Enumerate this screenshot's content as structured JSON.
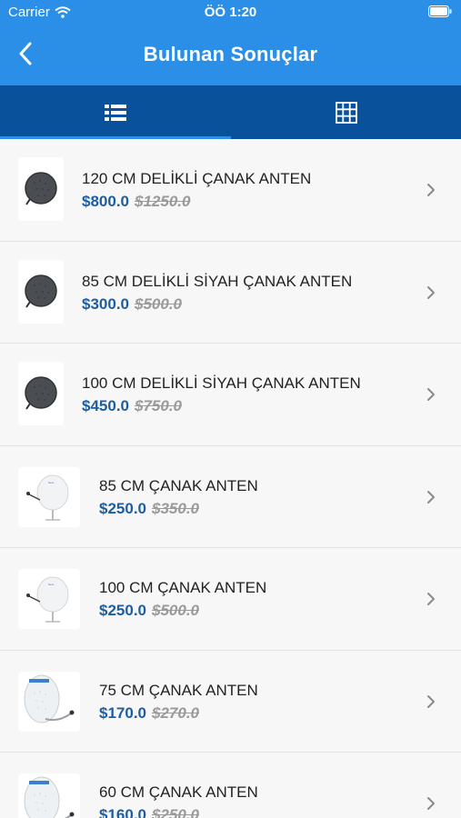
{
  "status_bar": {
    "carrier": "Carrier",
    "time": "ÖÖ 1:20"
  },
  "nav": {
    "title": "Bulunan Sonuçlar",
    "back_icon": "chevron-left-icon"
  },
  "tabs": [
    {
      "icon": "list-icon",
      "active": true
    },
    {
      "icon": "grid-icon",
      "active": false
    }
  ],
  "colors": {
    "header": "#2b8fe8",
    "tab_bar": "#09519a",
    "price": "#1d5da2"
  },
  "products": [
    {
      "name": "120 CM DELİKLİ ÇANAK ANTEN",
      "price": "$800.0",
      "old_price": "$1250.0",
      "image": "dark-dish"
    },
    {
      "name": "85 CM DELİKLİ SİYAH ÇANAK ANTEN",
      "price": "$300.0",
      "old_price": "$500.0",
      "image": "dark-dish"
    },
    {
      "name": "100 CM DELİKLİ SİYAH ÇANAK ANTEN",
      "price": "$450.0",
      "old_price": "$750.0",
      "image": "dark-dish"
    },
    {
      "name": "85 CM ÇANAK ANTEN",
      "price": "$250.0",
      "old_price": "$350.0",
      "image": "white-dish"
    },
    {
      "name": "100 CM ÇANAK ANTEN",
      "price": "$250.0",
      "old_price": "$500.0",
      "image": "white-dish"
    },
    {
      "name": "75 CM ÇANAK ANTEN",
      "price": "$170.0",
      "old_price": "$270.0",
      "image": "tall-dish"
    },
    {
      "name": "60 CM ÇANAK ANTEN",
      "price": "$160.0",
      "old_price": "$250.0",
      "image": "tall-dish"
    }
  ]
}
